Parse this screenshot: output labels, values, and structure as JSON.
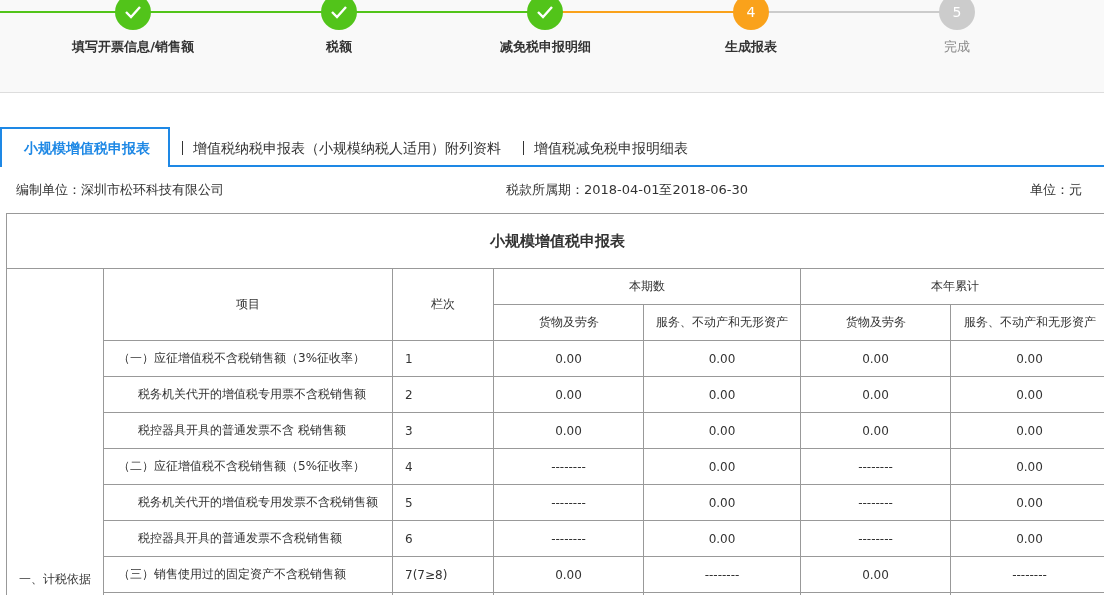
{
  "steps": [
    {
      "label": "填写开票信息/销售额",
      "kind": "done"
    },
    {
      "label": "税额",
      "kind": "done"
    },
    {
      "label": "减免税申报明细",
      "kind": "done"
    },
    {
      "label": "生成报表",
      "kind": "current",
      "number": "4"
    },
    {
      "label": "完成",
      "kind": "todo",
      "number": "5"
    }
  ],
  "tabs": [
    {
      "label": "小规模增值税申报表",
      "selected": true
    },
    {
      "label": "增值税纳税申报表（小规模纳税人适用）附列资料",
      "selected": false
    },
    {
      "label": "增值税减免税申报明细表",
      "selected": false
    }
  ],
  "info": {
    "unit_name": "编制单位：深圳市松环科技有限公司",
    "period": "税款所属期：2018-04-01至2018-06-30",
    "currency": "单位：元"
  },
  "table": {
    "title": "小规模增值税申报表",
    "section": "一、计税依据",
    "header": {
      "item": "项目",
      "line": "栏次",
      "current": "本期数",
      "ytd": "本年累计",
      "sub": [
        "货物及劳务",
        "服务、不动产和无形资产",
        "货物及劳务",
        "服务、不动产和无形资产"
      ]
    },
    "rows": [
      {
        "item": "（一）应征增值税不含税销售额（3%征收率）",
        "indent": false,
        "line": "1",
        "values": [
          "0.00",
          "0.00",
          "0.00",
          "0.00"
        ]
      },
      {
        "item": "税务机关代开的增值税专用票不含税销售额",
        "indent": true,
        "line": "2",
        "values": [
          "0.00",
          "0.00",
          "0.00",
          "0.00"
        ]
      },
      {
        "item": "税控器具开具的普通发票不含 税销售额",
        "indent": true,
        "line": "3",
        "values": [
          "0.00",
          "0.00",
          "0.00",
          "0.00"
        ]
      },
      {
        "item": "（二）应征增值税不含税销售额（5%征收率）",
        "indent": false,
        "line": "4",
        "values": [
          "--------",
          "0.00",
          "--------",
          "0.00"
        ]
      },
      {
        "item": "税务机关代开的增值税专用发票不含税销售额",
        "indent": true,
        "line": "5",
        "values": [
          "--------",
          "0.00",
          "--------",
          "0.00"
        ]
      },
      {
        "item": "税控器具开具的普通发票不含税销售额",
        "indent": true,
        "line": "6",
        "values": [
          "--------",
          "0.00",
          "--------",
          "0.00"
        ]
      },
      {
        "item": "（三）销售使用过的固定资产不含税销售额",
        "indent": false,
        "line": "7(7≥8)",
        "values": [
          "0.00",
          "--------",
          "0.00",
          "--------"
        ]
      }
    ]
  }
}
